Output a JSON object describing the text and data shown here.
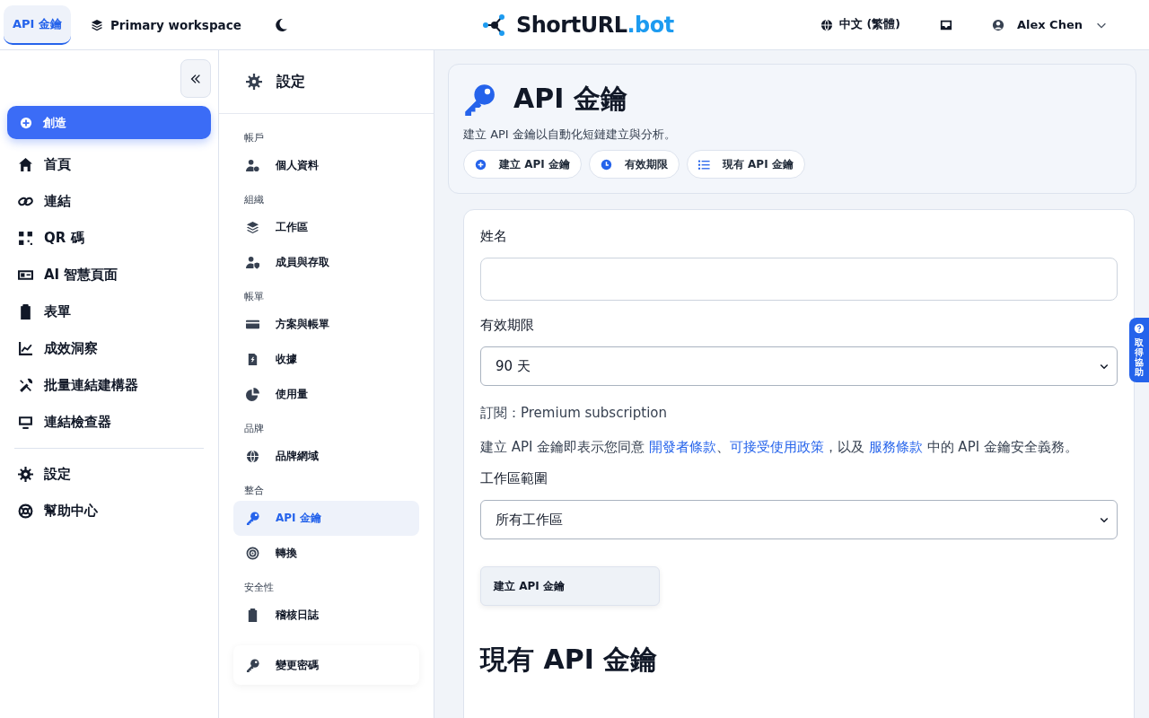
{
  "topbar": {
    "tabs": [
      {
        "label": "API 金鑰",
        "selected": true
      }
    ],
    "workspace": "Primary workspace",
    "logo": {
      "main": "ShortURL",
      "suffix": ".bot"
    },
    "language": "中文 (繁體)",
    "user": "Alex Chen"
  },
  "sidebar": {
    "create": "創造",
    "items": [
      {
        "label": "首頁"
      },
      {
        "label": "連結"
      },
      {
        "label": "QR 碼"
      },
      {
        "label": "AI 智慧頁面"
      },
      {
        "label": "表單"
      },
      {
        "label": "成效洞察"
      },
      {
        "label": "批量連結建構器"
      },
      {
        "label": "連結檢查器"
      }
    ],
    "footer_items": [
      {
        "label": "設定"
      },
      {
        "label": "幫助中心"
      }
    ]
  },
  "settings_nav": {
    "title": "設定",
    "groups": [
      {
        "heading": "帳戶",
        "items": [
          {
            "label": "個人資料",
            "selected": false
          }
        ]
      },
      {
        "heading": "組織",
        "items": [
          {
            "label": "工作區",
            "selected": false
          },
          {
            "label": "成員與存取",
            "selected": false
          }
        ]
      },
      {
        "heading": "帳單",
        "items": [
          {
            "label": "方案與帳單",
            "selected": false
          },
          {
            "label": "收據",
            "selected": false
          },
          {
            "label": "使用量",
            "selected": false
          }
        ]
      },
      {
        "heading": "品牌",
        "items": [
          {
            "label": "品牌網域",
            "selected": false
          }
        ]
      },
      {
        "heading": "整合",
        "items": [
          {
            "label": "API 金鑰",
            "selected": true
          },
          {
            "label": "轉換",
            "selected": false
          }
        ]
      },
      {
        "heading": "安全性",
        "items": [
          {
            "label": "稽核日誌",
            "selected": false
          }
        ]
      }
    ],
    "bottom_item": "變更密碼"
  },
  "page": {
    "title": "API 金鑰",
    "subtitle": "建立 API 金鑰以自動化短鏈建立與分析。",
    "chips": [
      "建立 API 金鑰",
      "有效期限",
      "現有 API 金鑰"
    ]
  },
  "form": {
    "name_label": "姓名",
    "expiry_label": "有效期限",
    "expiry_value": "90 天",
    "subscription": "訂閱：Premium subscription",
    "terms": {
      "before": "建立 API 金鑰即表示您同意 ",
      "link1": "開發者條款",
      "sep": "、",
      "link2": "可接受使用政策",
      "mid": "，以及 ",
      "link3": "服務條款",
      "after": " 中的 API 金鑰安全義務。"
    },
    "scope_label": "工作區範圍",
    "scope_value": "所有工作區",
    "submit": "建立 API 金鑰"
  },
  "existing_heading": "現有 API 金鑰",
  "help_tab": "取得協助"
}
